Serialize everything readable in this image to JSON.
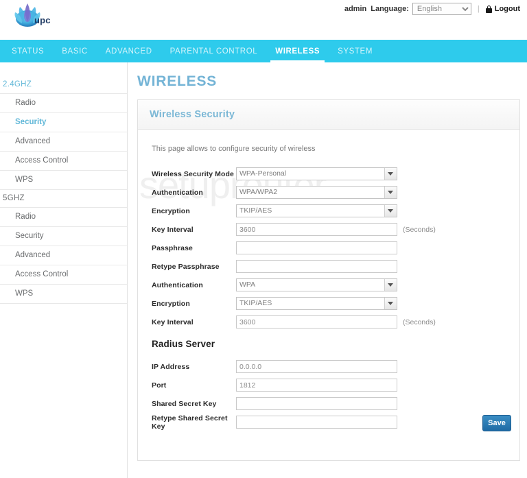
{
  "header": {
    "brand": "upc",
    "logo_icon": "upc-lotus-logo",
    "user": "admin",
    "language_label": "Language:",
    "language_value": "English",
    "language_options": [
      "English"
    ],
    "separator": "|",
    "lock_icon": "lock-icon",
    "logout_label": "Logout"
  },
  "nav": {
    "items": [
      {
        "label": "STATUS",
        "active": false
      },
      {
        "label": "BASIC",
        "active": false
      },
      {
        "label": "ADVANCED",
        "active": false
      },
      {
        "label": "PARENTAL CONTROL",
        "active": false
      },
      {
        "label": "WIRELESS",
        "active": true
      },
      {
        "label": "SYSTEM",
        "active": false
      }
    ]
  },
  "sidebar": {
    "groups": [
      {
        "title": "2.4GHZ",
        "accent": true,
        "items": [
          {
            "label": "Radio",
            "active": false
          },
          {
            "label": "Security",
            "active": true
          },
          {
            "label": "Advanced",
            "active": false
          },
          {
            "label": "Access Control",
            "active": false
          },
          {
            "label": "WPS",
            "active": false
          }
        ]
      },
      {
        "title": "5GHZ",
        "accent": false,
        "items": [
          {
            "label": "Radio",
            "active": false
          },
          {
            "label": "Security",
            "active": false
          },
          {
            "label": "Advanced",
            "active": false
          },
          {
            "label": "Access Control",
            "active": false
          },
          {
            "label": "WPS",
            "active": false
          }
        ]
      }
    ]
  },
  "main": {
    "page_title": "WIRELESS",
    "panel_title": "Wireless Security",
    "intro": "This page allows to configure security of wireless",
    "watermark": "setuprouter",
    "fields": {
      "security_mode_label": "Wireless Security Mode",
      "security_mode_value": "WPA-Personal",
      "auth1_label": "Authentication",
      "auth1_value": "WPA/WPA2",
      "enc1_label": "Encryption",
      "enc1_value": "TKIP/AES",
      "keyint1_label": "Key Interval",
      "keyint1_value": "3600",
      "keyint1_suffix": "(Seconds)",
      "passphrase_label": "Passphrase",
      "passphrase_value": "",
      "retype_passphrase_label": "Retype Passphrase",
      "retype_passphrase_value": "",
      "auth2_label": "Authentication",
      "auth2_value": "WPA",
      "enc2_label": "Encryption",
      "enc2_value": "TKIP/AES",
      "keyint2_label": "Key Interval",
      "keyint2_value": "3600",
      "keyint2_suffix": "(Seconds)",
      "radius_heading": "Radius Server",
      "ip_label": "IP Address",
      "ip_value": "0.0.0.0",
      "port_label": "Port",
      "port_value": "1812",
      "secret_label": "Shared Secret Key",
      "secret_value": "",
      "retype_secret_label": "Retype Shared Secret Key",
      "retype_secret_value": ""
    },
    "save_label": "Save"
  },
  "colors": {
    "nav_bg": "#2ecbec",
    "accent": "#74b4d6",
    "save_button": "#2a79b0"
  }
}
